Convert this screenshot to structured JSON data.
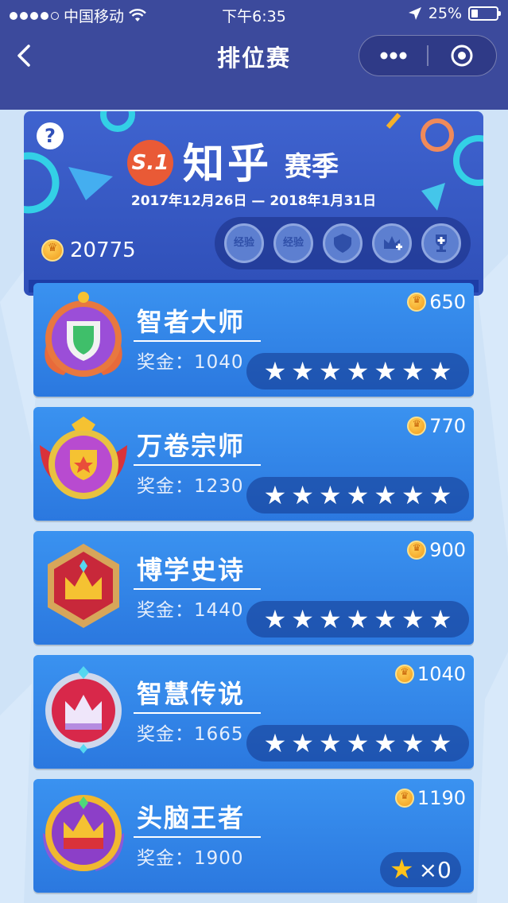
{
  "status_bar": {
    "carrier": "中国移动",
    "time": "下午6:35",
    "battery": "25%",
    "battery_level": 0.25
  },
  "nav": {
    "title": "排位赛",
    "more_icon": "more-dots-icon",
    "close_icon": "target-circle-icon",
    "back_icon": "chevron-left-icon"
  },
  "banner": {
    "help": "?",
    "season_badge": "S.1",
    "brand": "知乎",
    "season_word": "赛季",
    "dates": "2017年12月26日 — 2018年1月31日",
    "coins": "20775",
    "badges": [
      "经验",
      "经验",
      "",
      "",
      ""
    ]
  },
  "ranks": [
    {
      "name": "智者大师",
      "prize": "奖金：1040",
      "cost": "650",
      "stars": 7
    },
    {
      "name": "万卷宗师",
      "prize": "奖金：1230",
      "cost": "770",
      "stars": 7
    },
    {
      "name": "博学史诗",
      "prize": "奖金：1440",
      "cost": "900",
      "stars": 7
    },
    {
      "name": "智慧传说",
      "prize": "奖金：1665",
      "cost": "1040",
      "stars": 7
    },
    {
      "name": "头脑王者",
      "prize": "奖金：1900",
      "cost": "1190",
      "star_count": "×0"
    }
  ],
  "colors": {
    "nav_bg": "#3c4a9c",
    "card_bg": "#3a92f0",
    "coin": "#f5b02a",
    "accent": "#e95a36"
  }
}
